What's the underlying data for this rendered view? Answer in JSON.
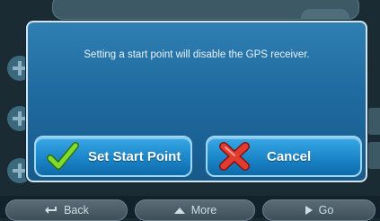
{
  "dialog": {
    "message": "Setting a start point will disable the GPS receiver.",
    "buttons": {
      "set_start_point": {
        "label": "Set Start Point",
        "icon": "checkmark-icon"
      },
      "cancel": {
        "label": "Cancel",
        "icon": "red-x-icon"
      }
    }
  },
  "bottom_bar": {
    "back": {
      "label": "Back",
      "icon": "back-arrow-icon"
    },
    "more": {
      "label": "More",
      "icon": "up-chevron-icon"
    },
    "go": {
      "label": "Go",
      "icon": "right-chevron-icon"
    }
  },
  "colors": {
    "dialog_bg": "#1f6aa0",
    "button_bg": "#1b86c9",
    "checkmark": "#7fdb2c",
    "cancel_x": "#e23b2f"
  }
}
